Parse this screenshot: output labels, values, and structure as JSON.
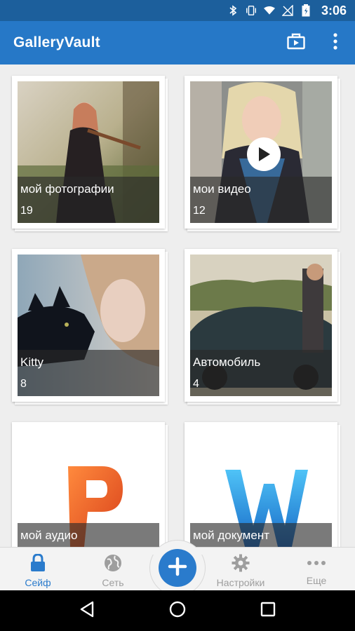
{
  "status_bar": {
    "time": "3:06"
  },
  "app_bar": {
    "title": "GalleryVault"
  },
  "albums": [
    {
      "name": "мой фотографии",
      "count": "19"
    },
    {
      "name": "мои видео",
      "count": "12"
    },
    {
      "name": "Kitty",
      "count": "8"
    },
    {
      "name": "Автомобиль",
      "count": "4"
    },
    {
      "name": "мой аудио",
      "count": ""
    },
    {
      "name": "мой документ",
      "count": ""
    }
  ],
  "bottom_nav": {
    "items": [
      {
        "label": "Сейф",
        "icon": "lock-icon"
      },
      {
        "label": "Сеть",
        "icon": "globe-icon"
      },
      {
        "label": "Настройки",
        "icon": "gear-icon"
      },
      {
        "label": "Еще",
        "icon": "more-horizontal-icon"
      }
    ]
  },
  "colors": {
    "primary": "#2678c7",
    "status_bar": "#1c5f9c",
    "accent": "#2a7bcc"
  }
}
